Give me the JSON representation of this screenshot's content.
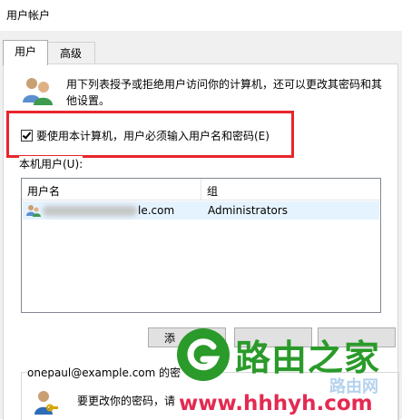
{
  "window": {
    "title": "用户帐户"
  },
  "tabs": [
    {
      "label": "用户"
    },
    {
      "label": "高级"
    }
  ],
  "users_tab": {
    "description": "用下列表授予或拒绝用户访问你的计算机，还可以更改其密码和其他设置。",
    "require_password_checkbox": {
      "label": "要使用本计算机，用户必须输入用户名和密码(E)",
      "checked": true
    },
    "local_users_label": "本机用户(U):",
    "columns": [
      "用户名",
      "组"
    ],
    "rows": [
      {
        "user_visible_suffix": "le.com",
        "group": "Administrators"
      }
    ],
    "buttons": {
      "add": "添",
      "remove": "",
      "properties": ""
    },
    "password_group": {
      "title": "onepaul@example.com 的密",
      "description": "要更改你的密码，请"
    }
  },
  "watermark": {
    "text": "路由之家",
    "url": "www.hhhyh.com",
    "sub": "路由网"
  },
  "colors": {
    "highlight": "#e8252b",
    "selection": "#e5f3ff",
    "watermark_green": "#2a9a2a",
    "watermark_red": "#e32a52"
  },
  "icons": [
    "users-icon",
    "user-row-icon",
    "key-user-icon",
    "routerhome-logo-icon"
  ]
}
